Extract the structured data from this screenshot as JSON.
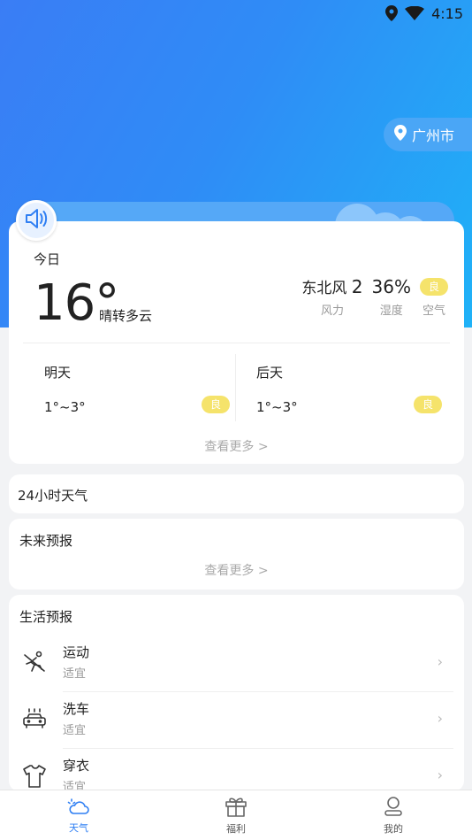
{
  "status_bar": {
    "time": "4:15"
  },
  "location": {
    "city": "广州市"
  },
  "today": {
    "label": "今日",
    "temperature": "16°",
    "condition": "晴转多云",
    "wind_direction": "东北风",
    "wind_level": "2",
    "wind_label": "风力",
    "humidity": "36%",
    "humidity_label": "湿度",
    "air_quality": "良",
    "air_label": "空气"
  },
  "forecast_days": [
    {
      "name": "明天",
      "range": "1°~3°",
      "air": "良"
    },
    {
      "name": "后天",
      "range": "1°~3°",
      "air": "良"
    }
  ],
  "see_more": "查看更多 >",
  "hourly": {
    "title": "24小时天气"
  },
  "future": {
    "title": "未来预报",
    "see_more": "查看更多 >"
  },
  "life": {
    "title": "生活预报",
    "items": [
      {
        "name": "运动",
        "status": "适宜",
        "icon": "sport-icon"
      },
      {
        "name": "洗车",
        "status": "适宜",
        "icon": "car-wash-icon"
      },
      {
        "name": "穿衣",
        "status": "适宜",
        "icon": "clothing-icon"
      }
    ]
  },
  "tabs": [
    {
      "label": "天气",
      "icon": "weather-icon",
      "active": true
    },
    {
      "label": "福利",
      "icon": "gift-icon",
      "active": false
    },
    {
      "label": "我的",
      "icon": "profile-icon",
      "active": false
    }
  ],
  "colors": {
    "accent": "#2f7ff3",
    "badge": "#f5e36b",
    "hero_start": "#3a7df5",
    "hero_end": "#1fb2f7"
  }
}
